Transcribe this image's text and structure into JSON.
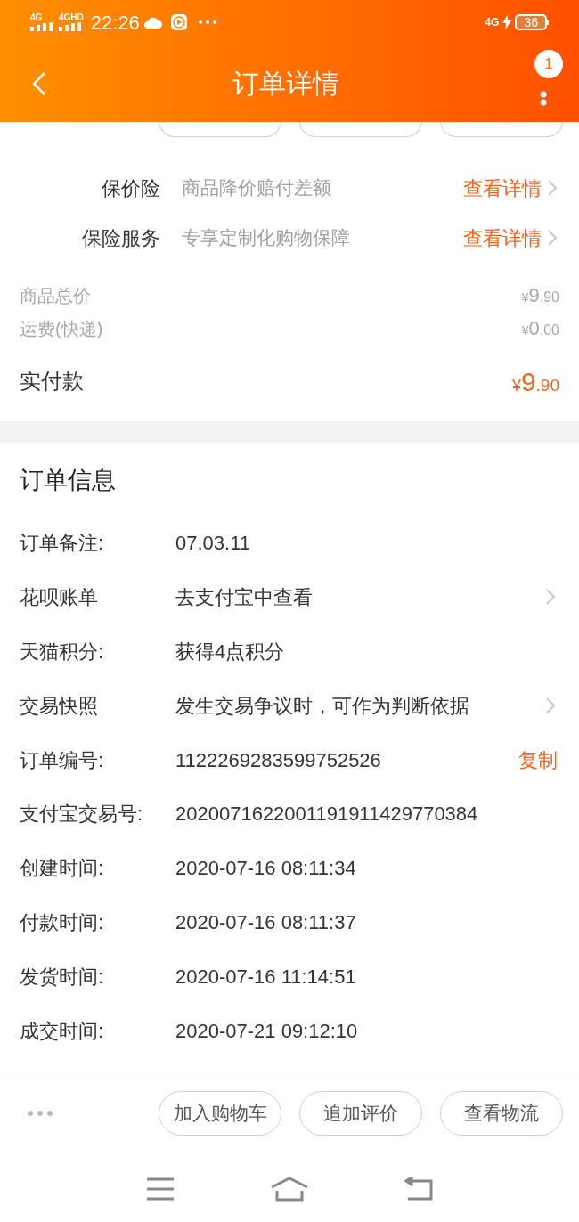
{
  "status_bar": {
    "sim1": "4G",
    "sim2": "4GHD",
    "time": "22:26",
    "network": "4G",
    "battery": "36"
  },
  "header": {
    "title": "订单详情",
    "badge": "1"
  },
  "services": [
    {
      "label": "保价险",
      "desc": "商品降价赔付差额",
      "action": "查看详情"
    },
    {
      "label": "保险服务",
      "desc": "专享定制化购物保障",
      "action": "查看详情"
    }
  ],
  "prices": [
    {
      "label": "商品总价",
      "currency": "¥",
      "integer": "9",
      "decimal": ".90",
      "kind": "minor"
    },
    {
      "label": "运费(快递)",
      "currency": "¥",
      "integer": "0",
      "decimal": ".00",
      "kind": "minor"
    },
    {
      "label": "实付款",
      "currency": "¥",
      "integer": "9",
      "decimal": ".90",
      "kind": "total"
    }
  ],
  "order_info": {
    "title": "订单信息",
    "rows": [
      {
        "label": "订单备注:",
        "value": "07.03.11",
        "kind": "plain"
      },
      {
        "label": "花呗账单",
        "value": "去支付宝中查看",
        "kind": "link"
      },
      {
        "label": "天猫积分:",
        "value": "获得4点积分",
        "kind": "plain"
      },
      {
        "label": "交易快照",
        "value": "发生交易争议时，可作为判断依据",
        "kind": "link"
      },
      {
        "label": "订单编号:",
        "value": "1122269283599752526",
        "kind": "copy",
        "action": "复制"
      },
      {
        "label": "支付宝交易号:",
        "value": "2020071622001191911429770384",
        "kind": "plain"
      },
      {
        "label": "创建时间:",
        "value": "2020-07-16 08:11:34",
        "kind": "plain"
      },
      {
        "label": "付款时间:",
        "value": "2020-07-16 08:11:37",
        "kind": "plain"
      },
      {
        "label": "发货时间:",
        "value": "2020-07-16 11:14:51",
        "kind": "plain"
      },
      {
        "label": "成交时间:",
        "value": "2020-07-21 09:12:10",
        "kind": "plain"
      }
    ]
  },
  "action_bar": {
    "buttons": [
      "加入购物车",
      "追加评价",
      "查看物流"
    ]
  }
}
